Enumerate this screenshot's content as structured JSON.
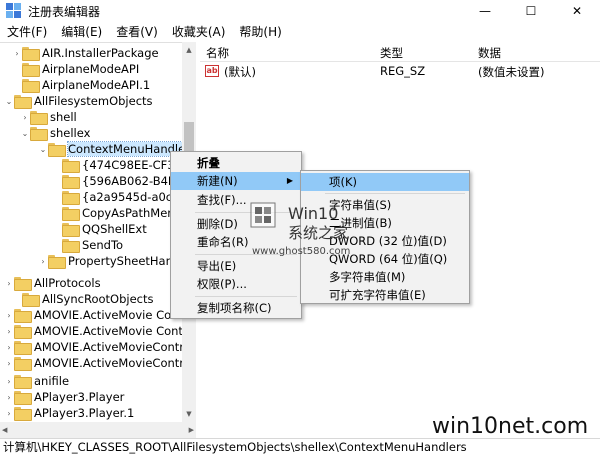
{
  "window": {
    "title": "注册表编辑器",
    "minimize": "—",
    "maximize": "☐",
    "close": "✕"
  },
  "menu": [
    "文件(F)",
    "编辑(E)",
    "查看(V)",
    "收藏夹(A)",
    "帮助(H)"
  ],
  "tree": [
    {
      "label": "AIR.InstallerPackage",
      "twisty": "›"
    },
    {
      "label": "AirplaneModeAPI",
      "twisty": ""
    },
    {
      "label": "AirplaneModeAPI.1",
      "twisty": ""
    },
    {
      "label": "AllFilesystemObjects",
      "twisty": "⌄"
    },
    {
      "label": "shell",
      "twisty": "›"
    },
    {
      "label": "shellex",
      "twisty": "⌄"
    },
    {
      "label": "ContextMenuHandlers",
      "twisty": "⌄"
    },
    {
      "label": "{474C98EE-CF3D-",
      "twisty": ""
    },
    {
      "label": "{596AB062-B4D2",
      "twisty": ""
    },
    {
      "label": "{a2a9545d-a0c2-",
      "twisty": ""
    },
    {
      "label": "CopyAsPathMenu",
      "twisty": ""
    },
    {
      "label": "QQShellExt",
      "twisty": ""
    },
    {
      "label": "SendTo",
      "twisty": ""
    },
    {
      "label": "PropertySheetHandl",
      "twisty": "›"
    },
    {
      "label": "AllProtocols",
      "twisty": "›"
    },
    {
      "label": "AllSyncRootObjects",
      "twisty": ""
    },
    {
      "label": "AMOVIE.ActiveMovie Contro",
      "twisty": "›"
    },
    {
      "label": "AMOVIE.ActiveMovie Control.",
      "twisty": "›"
    },
    {
      "label": "AMOVIE.ActiveMovieControl",
      "twisty": "›"
    },
    {
      "label": "AMOVIE.ActiveMovieControl.2",
      "twisty": "›"
    },
    {
      "label": "anifile",
      "twisty": "›"
    },
    {
      "label": "APlayer3.Player",
      "twisty": "›"
    },
    {
      "label": "APlayer3.Player.1",
      "twisty": "›"
    }
  ],
  "list": {
    "col_name": "名称",
    "col_type": "类型",
    "col_data": "数据",
    "rows": [
      {
        "icon": "ab",
        "name": "(默认)",
        "type": "REG_SZ",
        "data": "(数值未设置)"
      }
    ]
  },
  "context_menu": {
    "items": [
      "折叠",
      "新建(N)",
      "查找(F)...",
      "删除(D)",
      "重命名(R)",
      "导出(E)",
      "权限(P)...",
      "复制项名称(C)"
    ]
  },
  "submenu": {
    "items": [
      "项(K)",
      "字符串值(S)",
      "二进制值(B)",
      "DWORD (32 位)值(D)",
      "QWORD (64 位)值(Q)",
      "多字符串值(M)",
      "可扩充字符串值(E)"
    ]
  },
  "status": "计算机\\HKEY_CLASSES_ROOT\\AllFilesystemObjects\\shellex\\ContextMenuHandlers",
  "watermark": {
    "title": "Win10",
    "subtitle": "系统之家",
    "url": "www.ghost580.com",
    "corner": "win10net.com"
  },
  "colors": {
    "highlight": "#91c9f7",
    "selection": "#cce8ff",
    "folder": "#f3cf63"
  }
}
